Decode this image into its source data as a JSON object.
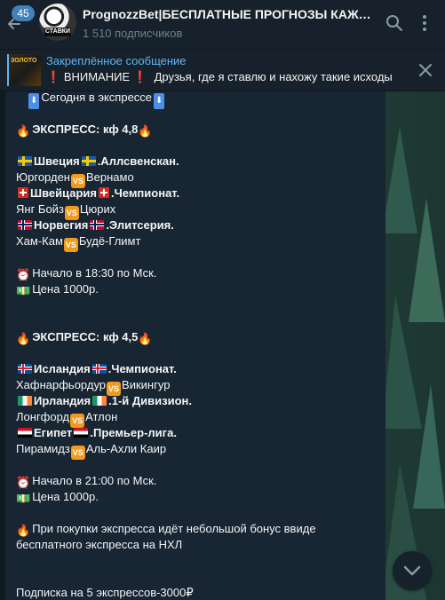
{
  "header": {
    "badge": "45",
    "channel_title": "PrognozzBet|БЕСПЛАТНЫЕ ПРОГНОЗЫ КАЖДЫЙ ДЕНЬ",
    "subscribers": "1 510 подписчиков",
    "avatar_label": "СТАВКИ"
  },
  "pinned": {
    "title": "Закреплённое сообщение",
    "text": "ВНИМАНИЕ",
    "text_rest": "Друзья, где я ставлю и нахожу такие исходы"
  },
  "message": {
    "today": "Сегодня в экспрессе",
    "express1": {
      "title": "ЭКСПРЕСС: кф 4,8",
      "league1": ".Аллсвенскан.",
      "country1": "Швеция",
      "home1": "Юргорден",
      "away1": "Вернамо",
      "country2": "Швейцария",
      "league2": ".Чемпионат.",
      "home2": "Янг Бойз",
      "away2": "Цюрих",
      "country3": "Норвегия",
      "league3": ".Элитсерия.",
      "home3": "Хам-Кам",
      "away3": "Будё-Глимт",
      "start": "Начало в 18:30 по Мск.",
      "price": "Цена 1000р."
    },
    "express2": {
      "title": "ЭКСПРЕСС: кф 4,5",
      "country1": "Исландия",
      "league1": ".Чемпионат.",
      "home1": "Хафнарфьордур",
      "away1": "Викингур",
      "country2": "Ирландия",
      "league2": ".1-й Дивизион.",
      "home2": "Лонгфорд",
      "away2": "Атлон",
      "country3": "Египет",
      "league3": ".Премьер-лига.",
      "home3": "Пирамидз",
      "away3": "Аль-Ахли Каир",
      "start": "Начало в 21:00 по Мск.",
      "price": "Цена 1000р."
    },
    "bonus_line1": "При покупки экспресса идёт небольшой бонус ввиде",
    "bonus_line2": "бесплатного экспресса на НХЛ",
    "subscription": "Подписка на 5 экспрессов-3000₽",
    "vs_label": "VS"
  },
  "colors": {
    "background": "#17212b",
    "bubble": "#182533",
    "accent": "#5eb5f7",
    "badge": "#4082bc",
    "vs": "#f29a1c",
    "muted": "#6d7f8f"
  },
  "icons": [
    "back-arrow-icon",
    "search-icon",
    "more-icon",
    "close-icon",
    "fire-icon",
    "alarm-clock-icon",
    "money-icon",
    "down-arrow-icon",
    "exclamation-icon"
  ]
}
